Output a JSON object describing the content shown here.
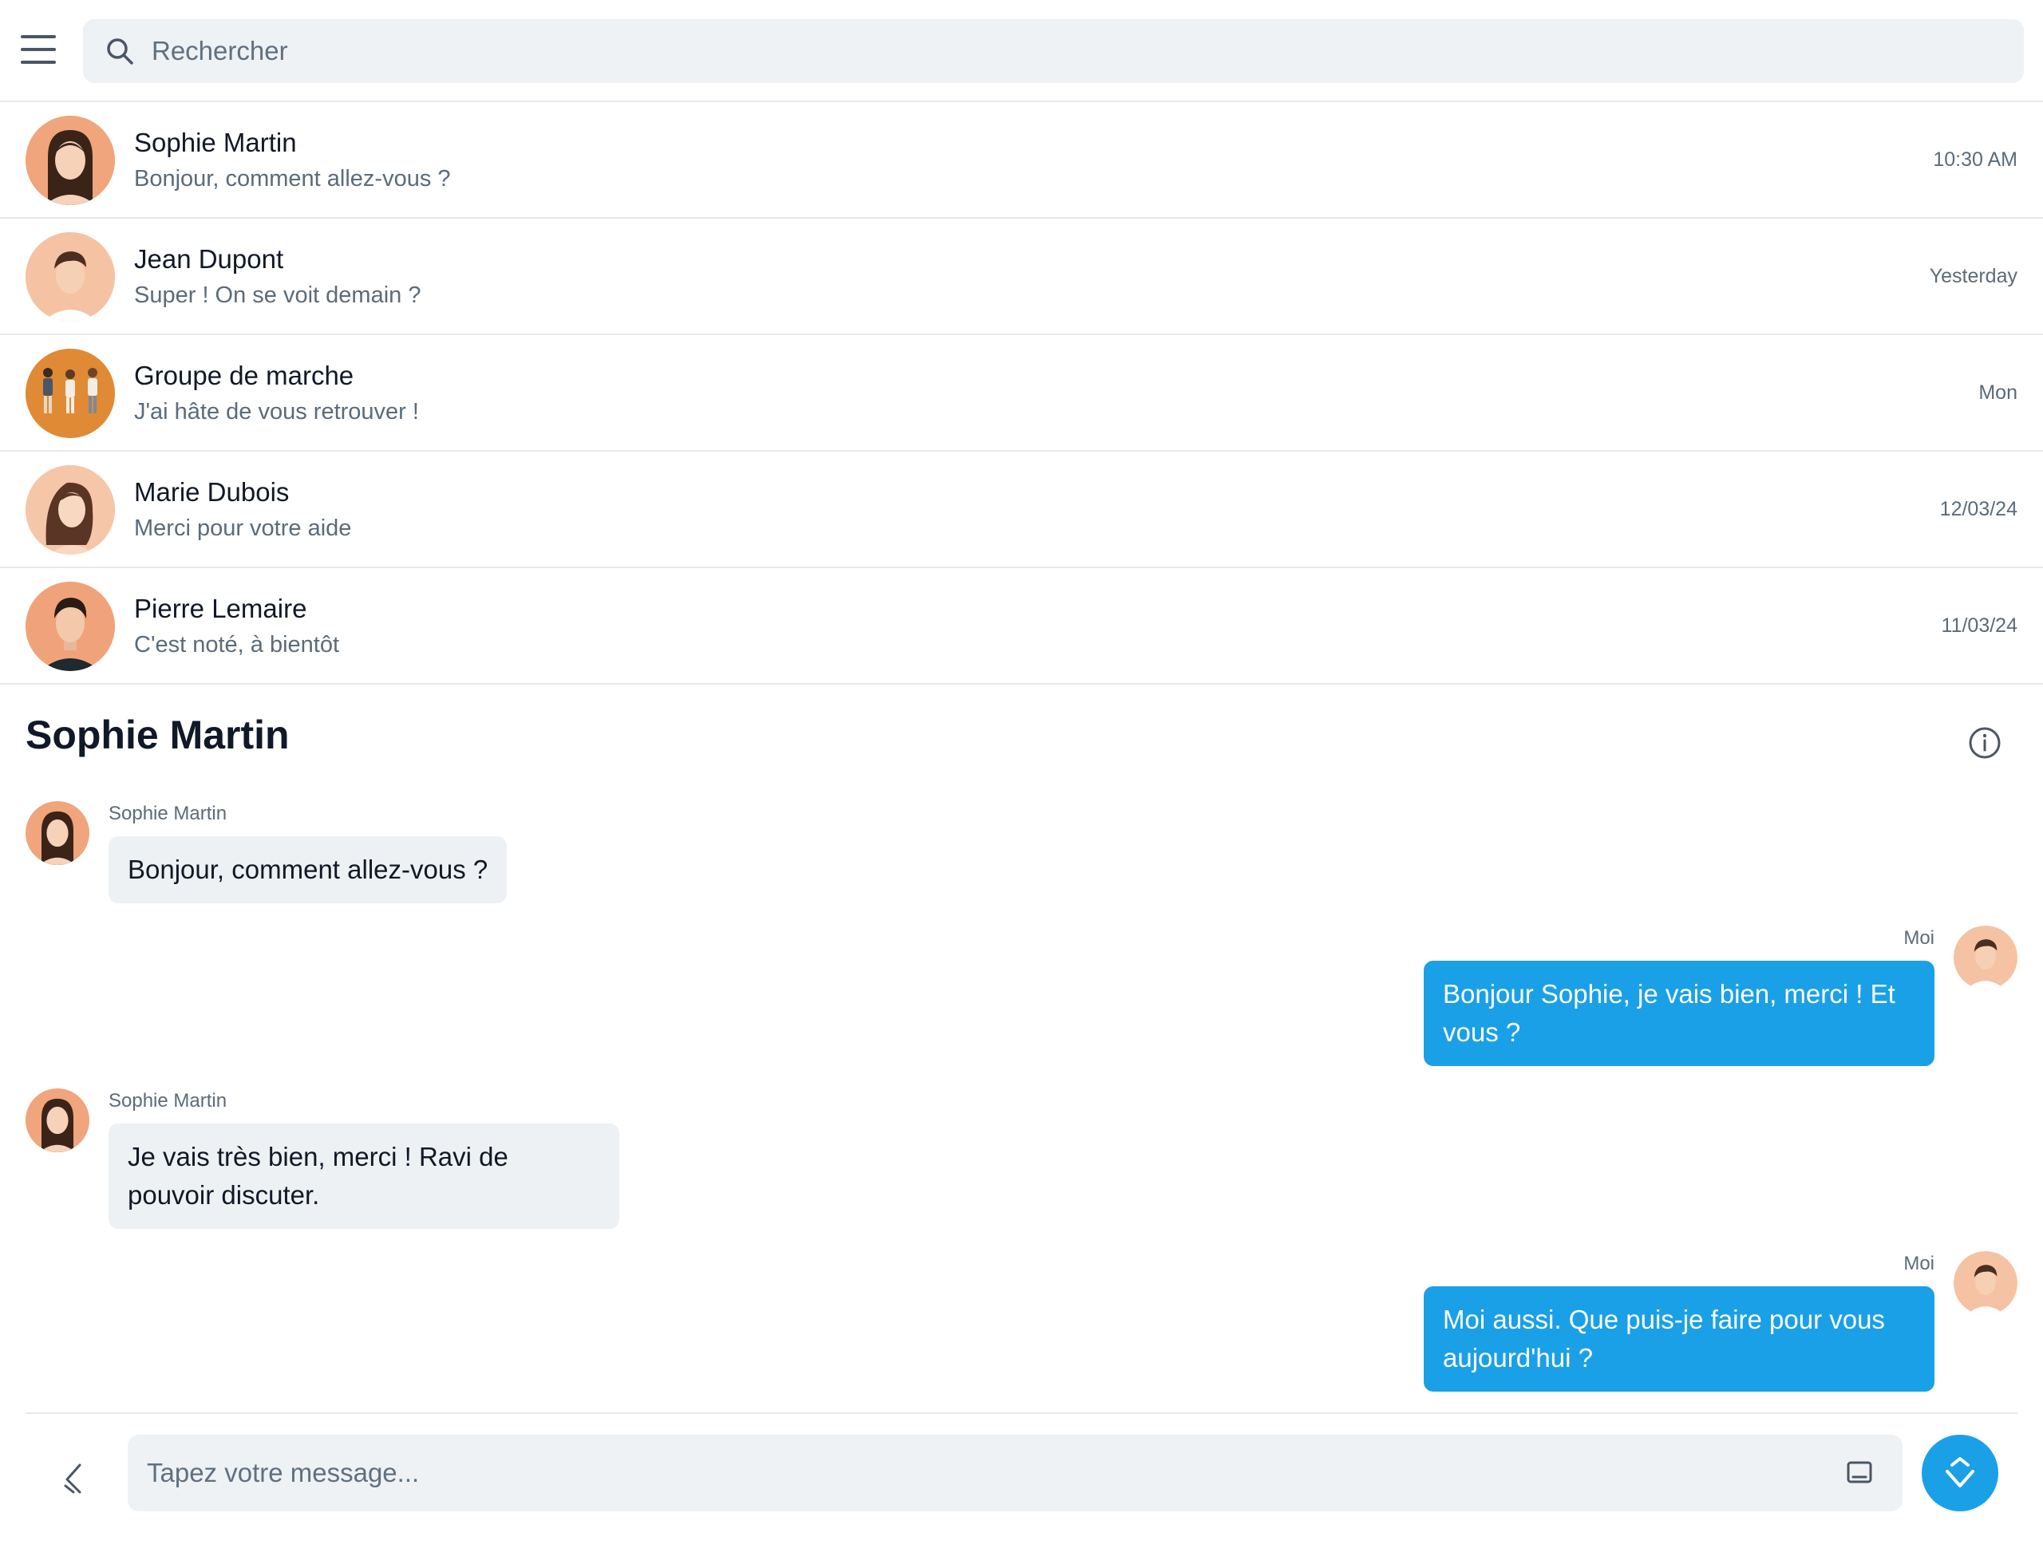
{
  "search": {
    "placeholder": "Rechercher"
  },
  "conversations": [
    {
      "name": "Sophie Martin",
      "preview": "Bonjour, comment allez-vous ?",
      "time": "10:30 AM"
    },
    {
      "name": "Jean Dupont",
      "preview": "Super ! On se voit demain ?",
      "time": "Yesterday"
    },
    {
      "name": "Groupe de marche",
      "preview": "J'ai hâte de vous retrouver !",
      "time": "Mon"
    },
    {
      "name": "Marie Dubois",
      "preview": "Merci pour votre aide",
      "time": "12/03/24"
    },
    {
      "name": "Pierre Lemaire",
      "preview": "C'est noté, à bientôt",
      "time": "11/03/24"
    }
  ],
  "chat": {
    "title": "Sophie Martin",
    "messages": [
      {
        "sender": "Sophie Martin",
        "text": "Bonjour, comment allez-vous ?"
      },
      {
        "sender": "Moi",
        "text": "Bonjour Sophie, je vais bien, merci ! Et vous ?"
      },
      {
        "sender": "Sophie Martin",
        "text": "Je vais très bien, merci ! Ravi de pouvoir discuter."
      },
      {
        "sender": "Moi",
        "text": "Moi aussi. Que puis-je faire pour vous aujourd'hui ?"
      }
    ]
  },
  "composer": {
    "placeholder": "Tapez votre message..."
  },
  "colors": {
    "accent": "#1aa0e6",
    "bubble_in": "#eef1f3",
    "muted_text": "#5b6b7a"
  },
  "icons": [
    "menu-icon",
    "search-icon",
    "info-icon",
    "attach-icon",
    "emoji-icon",
    "send-icon"
  ]
}
